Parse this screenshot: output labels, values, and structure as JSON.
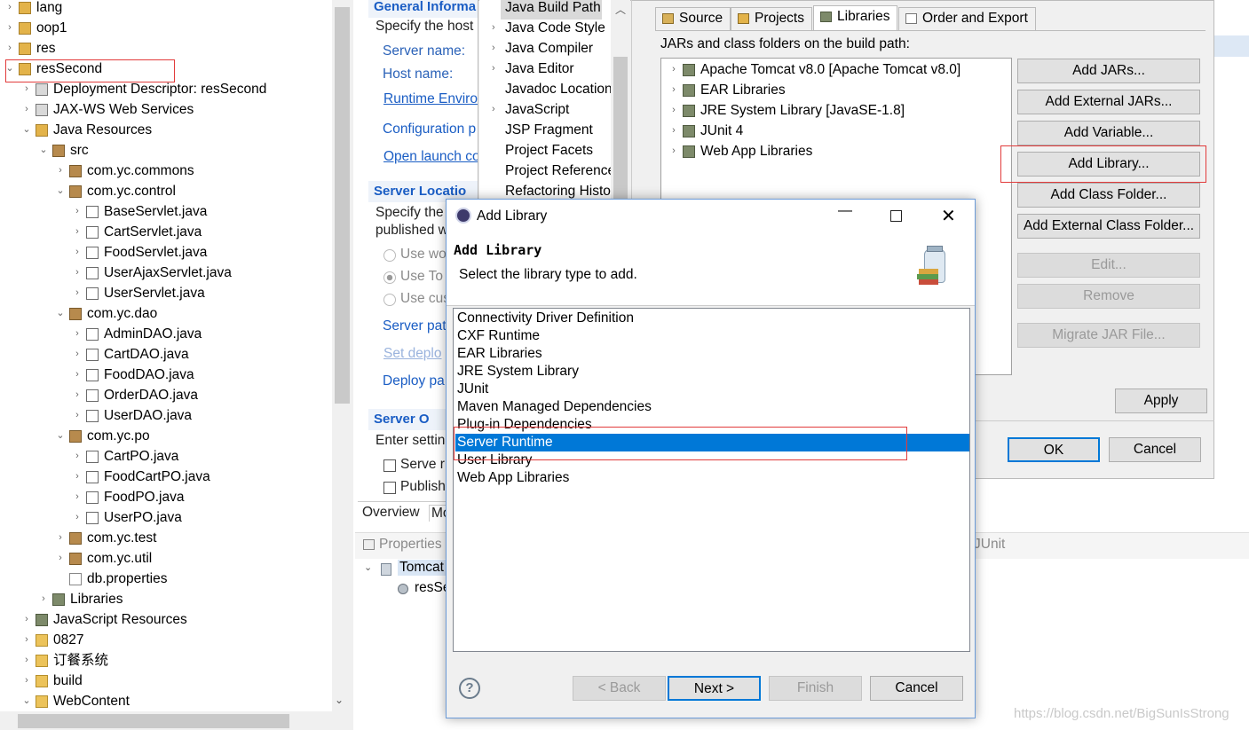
{
  "explorer": {
    "items": [
      {
        "label": "lang",
        "indent": 0,
        "icon": "project-icon",
        "arrow": "›"
      },
      {
        "label": "oop1",
        "indent": 0,
        "icon": "project-icon",
        "arrow": "›"
      },
      {
        "label": "res",
        "indent": 0,
        "icon": "project-icon",
        "arrow": "›"
      },
      {
        "label": "resSecond",
        "indent": 0,
        "icon": "project-icon",
        "arrow": "⌄"
      },
      {
        "label": "Deployment Descriptor: resSecond",
        "indent": 1,
        "icon": "descriptor-icon",
        "arrow": "›"
      },
      {
        "label": "JAX-WS Web Services",
        "indent": 1,
        "icon": "webservice-icon",
        "arrow": "›"
      },
      {
        "label": "Java Resources",
        "indent": 1,
        "icon": "java-resources-icon",
        "arrow": "⌄"
      },
      {
        "label": "src",
        "indent": 2,
        "icon": "source-folder-icon",
        "arrow": "⌄"
      },
      {
        "label": "com.yc.commons",
        "indent": 3,
        "icon": "package-icon",
        "arrow": "›"
      },
      {
        "label": "com.yc.control",
        "indent": 3,
        "icon": "package-icon",
        "arrow": "⌄"
      },
      {
        "label": "BaseServlet.java",
        "indent": 4,
        "icon": "java-file-icon",
        "arrow": "›"
      },
      {
        "label": "CartServlet.java",
        "indent": 4,
        "icon": "java-file-icon",
        "arrow": "›"
      },
      {
        "label": "FoodServlet.java",
        "indent": 4,
        "icon": "java-file-icon",
        "arrow": "›"
      },
      {
        "label": "UserAjaxServlet.java",
        "indent": 4,
        "icon": "java-file-icon",
        "arrow": "›"
      },
      {
        "label": "UserServlet.java",
        "indent": 4,
        "icon": "java-file-icon",
        "arrow": "›"
      },
      {
        "label": "com.yc.dao",
        "indent": 3,
        "icon": "package-icon",
        "arrow": "⌄"
      },
      {
        "label": "AdminDAO.java",
        "indent": 4,
        "icon": "java-file-icon",
        "arrow": "›"
      },
      {
        "label": "CartDAO.java",
        "indent": 4,
        "icon": "java-file-icon",
        "arrow": "›"
      },
      {
        "label": "FoodDAO.java",
        "indent": 4,
        "icon": "java-file-icon",
        "arrow": "›"
      },
      {
        "label": "OrderDAO.java",
        "indent": 4,
        "icon": "java-file-icon",
        "arrow": "›"
      },
      {
        "label": "UserDAO.java",
        "indent": 4,
        "icon": "java-file-icon",
        "arrow": "›"
      },
      {
        "label": "com.yc.po",
        "indent": 3,
        "icon": "package-icon",
        "arrow": "⌄"
      },
      {
        "label": "CartPO.java",
        "indent": 4,
        "icon": "java-file-icon",
        "arrow": "›"
      },
      {
        "label": "FoodCartPO.java",
        "indent": 4,
        "icon": "java-file-icon",
        "arrow": "›"
      },
      {
        "label": "FoodPO.java",
        "indent": 4,
        "icon": "java-file-icon",
        "arrow": "›"
      },
      {
        "label": "UserPO.java",
        "indent": 4,
        "icon": "java-file-icon",
        "arrow": "›"
      },
      {
        "label": "com.yc.test",
        "indent": 3,
        "icon": "package-icon",
        "arrow": "›"
      },
      {
        "label": "com.yc.util",
        "indent": 3,
        "icon": "package-icon",
        "arrow": "›"
      },
      {
        "label": "db.properties",
        "indent": 3,
        "icon": "file-icon",
        "arrow": ""
      },
      {
        "label": "Libraries",
        "indent": 2,
        "icon": "library-icon",
        "arrow": "›"
      },
      {
        "label": "JavaScript Resources",
        "indent": 1,
        "icon": "javascript-resources-icon",
        "arrow": "›"
      },
      {
        "label": "0827",
        "indent": 1,
        "icon": "folder-icon",
        "arrow": "›"
      },
      {
        "label": "订餐系统",
        "indent": 1,
        "icon": "folder-icon",
        "arrow": "›"
      },
      {
        "label": "build",
        "indent": 1,
        "icon": "folder-icon",
        "arrow": "›"
      },
      {
        "label": "WebContent",
        "indent": 1,
        "icon": "folder-icon",
        "arrow": "⌄"
      }
    ]
  },
  "editor": {
    "general_title": "General Informa",
    "general_desc": "Specify the host",
    "server_name": "Server name:",
    "host_name": "Host name:",
    "runtime_env": "Runtime Enviro",
    "configuration": "Configuration p",
    "open_launch": "Open launch co",
    "server_locations": "Server Locatio",
    "loc_desc1": "Specify the",
    "loc_desc2": "published w",
    "opt_use_wo": "Use wo",
    "opt_use_to": "Use To",
    "opt_use_cu": "Use cus",
    "server_path": "Server pat",
    "set_deploy": "Set deplo",
    "deploy_path": "Deploy pa",
    "server_options": "Server O",
    "enter_settings": "Enter settin",
    "serve_mod": "Serve r",
    "publish_mod": "Publish",
    "tab_overview": "Overview",
    "tab_modules": "Mo"
  },
  "props": {
    "nav_items": [
      {
        "label": "Java Build Path",
        "arrow": "",
        "selected": true
      },
      {
        "label": "Java Code Style",
        "arrow": "›"
      },
      {
        "label": "Java Compiler",
        "arrow": "›"
      },
      {
        "label": "Java Editor",
        "arrow": "›"
      },
      {
        "label": "Javadoc Location",
        "arrow": ""
      },
      {
        "label": "JavaScript",
        "arrow": "›"
      },
      {
        "label": "JSP Fragment",
        "arrow": ""
      },
      {
        "label": "Project Facets",
        "arrow": ""
      },
      {
        "label": "Project References",
        "arrow": ""
      },
      {
        "label": "Refactoring History",
        "arrow": ""
      }
    ],
    "tabs": [
      "Source",
      "Projects",
      "Libraries",
      "Order and Export"
    ],
    "jars_label": "JARs and class folders on the build path:",
    "libraries": [
      "Apache Tomcat v8.0 [Apache Tomcat v8.0]",
      "EAR Libraries",
      "JRE System Library [JavaSE-1.8]",
      "JUnit 4",
      "Web App Libraries"
    ],
    "buttons": {
      "add_jars": "Add JARs...",
      "add_external_jars": "Add External JARs...",
      "add_variable": "Add Variable...",
      "add_library": "Add Library...",
      "add_class_folder": "Add Class Folder...",
      "add_external_class_folder": "Add External Class Folder...",
      "edit": "Edit...",
      "remove": "Remove",
      "migrate": "Migrate JAR File...",
      "apply": "Apply",
      "ok": "OK",
      "cancel": "Cancel"
    }
  },
  "lower": {
    "properties_tab": "Properties",
    "junit_tab": "JUnit",
    "tomcat_node": "Tomcat",
    "res_node": "resSe"
  },
  "dialog": {
    "title": "Add Library",
    "heading": "Add Library",
    "subtitle": "Select the library type to add.",
    "types": [
      "Connectivity Driver Definition",
      "CXF Runtime",
      "EAR Libraries",
      "JRE System Library",
      "JUnit",
      "Maven Managed Dependencies",
      "Plug-in Dependencies",
      "Server Runtime",
      "User Library",
      "Web App Libraries"
    ],
    "selected_index": 7,
    "buttons": {
      "back": "< Back",
      "next": "Next >",
      "finish": "Finish",
      "cancel": "Cancel"
    }
  },
  "watermark": "https://blog.csdn.net/BigSunIsStrong",
  "colors": {
    "link": "#1a5dc4",
    "selection": "#0078d7",
    "highlight_box": "#e23b3b"
  }
}
